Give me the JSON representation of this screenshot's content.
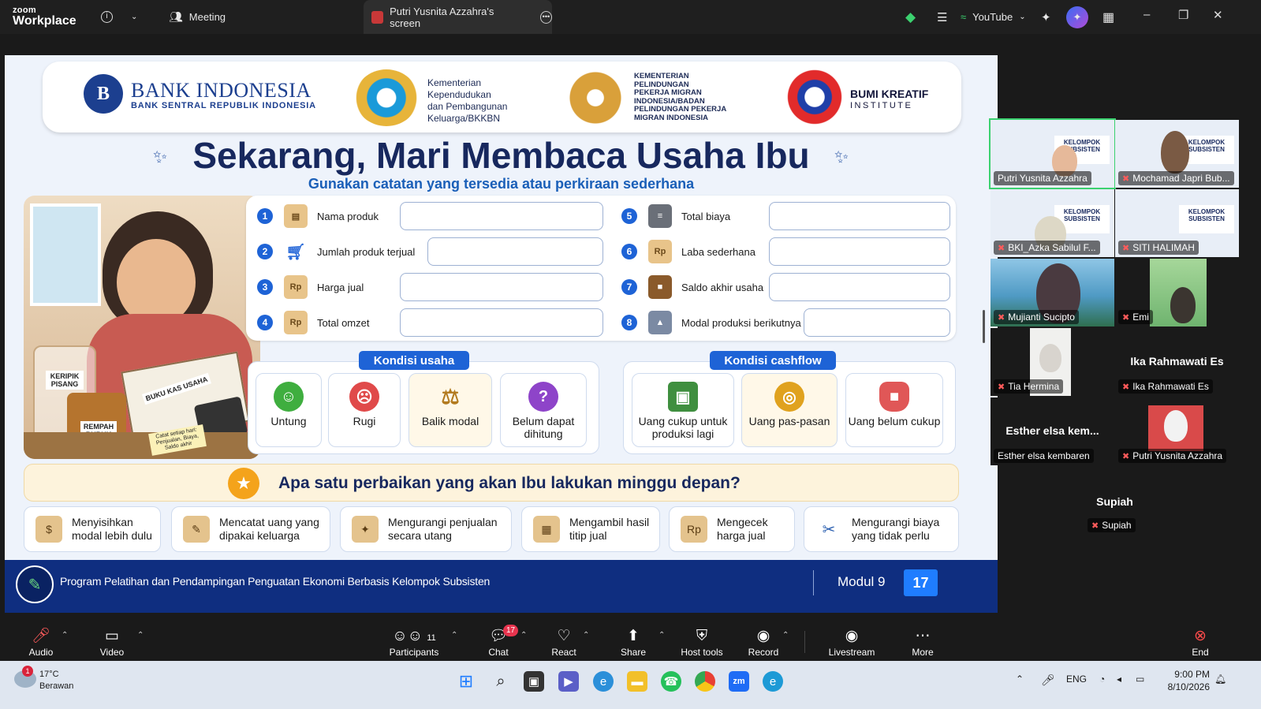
{
  "titlebar": {
    "brand_small": "zoom",
    "brand_big": "Workplace",
    "meeting_label": "Meeting",
    "share_tab_label": "Putri Yusnita Azzahra's screen",
    "youtube_label": "YouTube"
  },
  "slide": {
    "bank_name": "BANK INDONESIA",
    "bank_sub": "BANK SENTRAL REPUBLIK INDONESIA",
    "bkkbn_text": [
      "Kementerian",
      "Kependudukan",
      "dan Pembangunan",
      "Keluarga/BKKBN"
    ],
    "kp2mi_text": [
      "KEMENTERIAN",
      "PELINDUNGAN",
      "PEKERJA MIGRAN",
      "INDONESIA/BADAN",
      "PELINDUNGAN PEKERJA",
      "MIGRAN INDONESIA"
    ],
    "bki_name": "BUMI KREATIF",
    "bki_sub": "INSTITUTE",
    "title": "Sekarang, Mari Membaca Usaha Ibu",
    "subtitle": "Gunakan catatan yang tersedia atau perkiraan sederhana",
    "illustration_labels": {
      "jar": "KERIPIK PISANG",
      "jar2": "REMPAH BUBUK",
      "book": "BUKU KAS USAHA",
      "note": "Catat setiap hari: Penjualan, Biaya, Saldo akhir"
    },
    "form_left": [
      {
        "num": "1",
        "label": "Nama produk"
      },
      {
        "num": "2",
        "label": "Jumlah produk terjual"
      },
      {
        "num": "3",
        "label": "Harga jual"
      },
      {
        "num": "4",
        "label": "Total omzet"
      }
    ],
    "form_right": [
      {
        "num": "5",
        "label": "Total biaya"
      },
      {
        "num": "6",
        "label": "Laba sederhana"
      },
      {
        "num": "7",
        "label": "Saldo akhir usaha"
      },
      {
        "num": "8",
        "label": "Modal produksi berikutnya"
      }
    ],
    "kondisi_usaha": {
      "label": "Kondisi usaha",
      "cards": [
        {
          "label": "Untung",
          "icon": "smile-icon",
          "color": "#3fae3f"
        },
        {
          "label": "Rugi",
          "icon": "sad-icon",
          "color": "#e04a4a"
        },
        {
          "label": "Balik modal",
          "icon": "scale-icon",
          "color": "#c98a24"
        },
        {
          "label": "Belum dapat dihitung",
          "icon": "question-icon",
          "color": "#8e44c9"
        }
      ]
    },
    "kondisi_cashflow": {
      "label": "Kondisi cashflow",
      "cards": [
        {
          "label": "Uang cukup untuk produksi lagi",
          "icon": "wallet-icon",
          "color": "#3f8f3f"
        },
        {
          "label": "Uang pas-pasan",
          "icon": "coins-icon",
          "color": "#e0a21e"
        },
        {
          "label": "Uang belum cukup",
          "icon": "purse-icon",
          "color": "#e05757"
        }
      ]
    },
    "question": "Apa satu perbaikan yang akan Ibu lakukan minggu depan?",
    "options": [
      {
        "label": "Menyisihkan modal lebih dulu",
        "icon": "money-bag-icon"
      },
      {
        "label": "Mencatat uang yang dipakai keluarga",
        "icon": "notepad-icon"
      },
      {
        "label": "Mengurangi penjualan secara utang",
        "icon": "handshake-icon"
      },
      {
        "label": "Mengambil hasil titip jual",
        "icon": "box-icon"
      },
      {
        "label": "Mengecek harga jual",
        "icon": "price-tag-icon"
      },
      {
        "label": "Mengurangi biaya yang tidak perlu",
        "icon": "scissors-icon"
      }
    ],
    "footer_text": "Program Pelatihan dan Pendampingan Penguatan Ekonomi Berbasis Kelompok Subsisten",
    "modul": "Modul 9",
    "page": "17"
  },
  "gallery": [
    {
      "name": "Putri Yusnita Azzahra",
      "type": "slide",
      "muted": false,
      "active": true
    },
    {
      "name": "Mochamad Japri Bub...",
      "type": "slide-person",
      "muted": true
    },
    {
      "name": "BKI_Azka Sabilul F...",
      "type": "slide-person",
      "muted": true
    },
    {
      "name": "SITI HALIMAH",
      "type": "slide",
      "muted": true
    },
    {
      "name": "Mujianti Sucipto",
      "type": "video",
      "muted": true
    },
    {
      "name": "Emi",
      "type": "video",
      "muted": true
    },
    {
      "name": "Tia Hermina",
      "type": "video",
      "muted": true
    },
    {
      "name": "Ika Rahmawati Es",
      "type": "name",
      "big": "Ika Rahmawati Es",
      "muted": true
    },
    {
      "name": "Esther elsa kembaren",
      "type": "name",
      "big": "Esther elsa kem...",
      "muted": false
    },
    {
      "name": "Putri Yusnita Azzahra",
      "type": "photo",
      "muted": true
    },
    {
      "name": "Supiah",
      "type": "name",
      "big": "Supiah",
      "muted": true
    }
  ],
  "toolbar": {
    "audio": "Audio",
    "video": "Video",
    "participants": "Participants",
    "participants_count": "11",
    "chat": "Chat",
    "chat_badge": "17",
    "react": "React",
    "share": "Share",
    "host_tools": "Host tools",
    "record": "Record",
    "livestream": "Livestream",
    "more": "More",
    "end": "End"
  },
  "taskbar": {
    "temp": "17°C",
    "weather": "Berawan",
    "weather_badge": "1",
    "lang": "ENG",
    "time": "9:00 PM",
    "date": "8/10/2026"
  }
}
